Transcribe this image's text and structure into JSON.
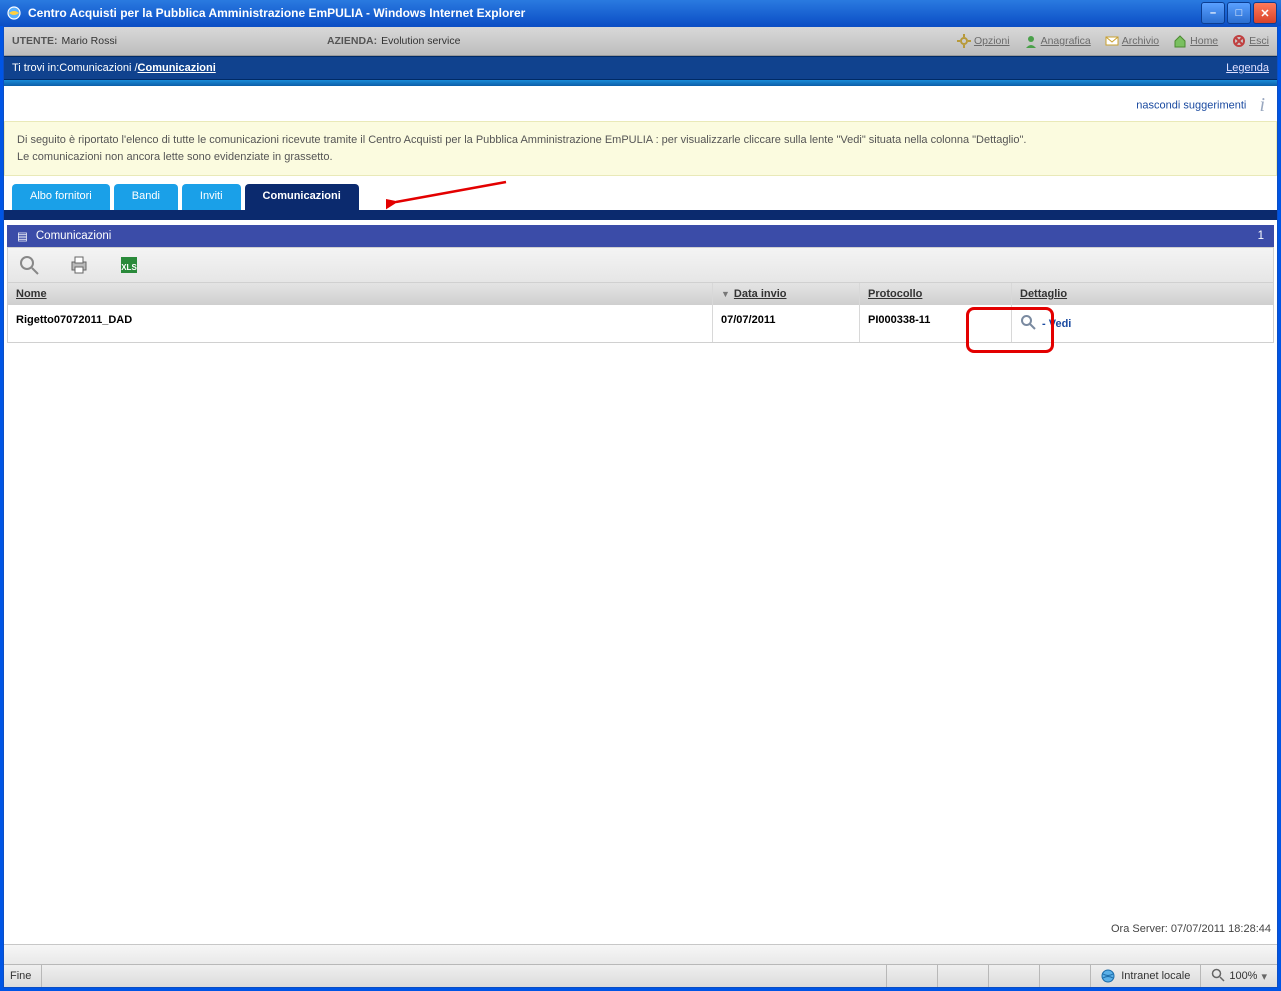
{
  "window": {
    "title": "Centro Acquisti per la Pubblica Amministrazione EmPULIA - Windows Internet Explorer"
  },
  "infobar": {
    "utente_label": "UTENTE:",
    "utente_value": "Mario Rossi",
    "azienda_label": "AZIENDA:",
    "azienda_value": "Evolution service",
    "links": {
      "opzioni": "Opzioni",
      "anagrafica": "Anagrafica",
      "archivio": "Archivio",
      "home": "Home",
      "esci": "Esci"
    }
  },
  "breadcrumb": {
    "prefix": "Ti trovi in:",
    "path": "Comunicazioni / ",
    "current": "Comunicazioni",
    "legenda": "Legenda"
  },
  "hints": {
    "hide_label": "nascondi suggerimenti",
    "text_line1": "Di seguito è riportato l'elenco di tutte le comunicazioni ricevute tramite il Centro Acquisti per la Pubblica Amministrazione EmPULIA : per visualizzarle cliccare sulla lente \"Vedi\" situata nella colonna \"Dettaglio\".",
    "text_line2": "Le comunicazioni non ancora lette sono evidenziate in grassetto."
  },
  "tabs": {
    "albo": "Albo fornitori",
    "bandi": "Bandi",
    "inviti": "Inviti",
    "comm": "Comunicazioni"
  },
  "section": {
    "title": "Comunicazioni",
    "count": "1"
  },
  "table": {
    "headers": {
      "nome": "Nome",
      "data": "Data invio",
      "proto": "Protocollo",
      "dett": "Dettaglio"
    },
    "rows": [
      {
        "nome": "Rigetto07072011_DAD",
        "data": "07/07/2011",
        "proto": "PI000338-11",
        "vedi": "- Vedi"
      }
    ]
  },
  "footer": {
    "server_time": "Ora Server: 07/07/2011 18:28:44"
  },
  "status": {
    "left": "Fine",
    "zone": "Intranet locale",
    "zoom": "100%"
  }
}
